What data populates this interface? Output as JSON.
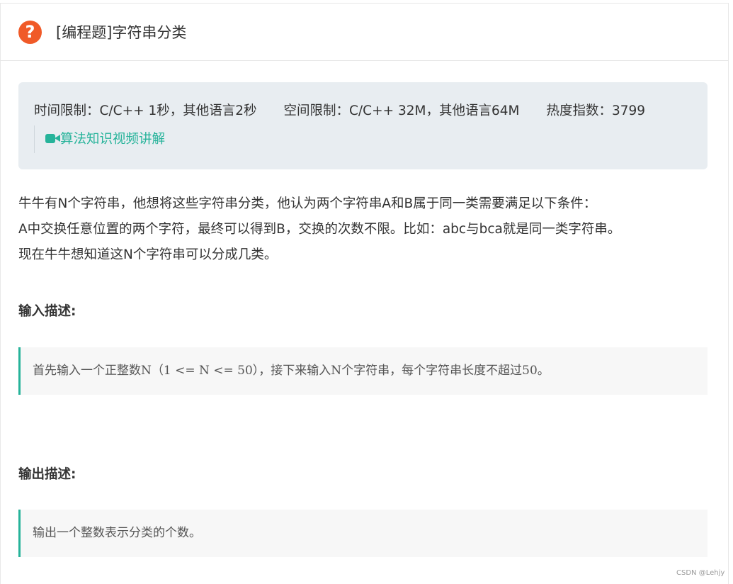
{
  "problem": {
    "title": "[编程题]字符串分类",
    "icon": "question-mark-icon"
  },
  "info": {
    "time_limit": "时间限制：C/C++ 1秒，其他语言2秒",
    "space_limit": "空间限制：C/C++ 32M，其他语言64M",
    "heat_index": "热度指数：3799",
    "video_link": "算法知识视频讲解",
    "video_icon": "video-camera-icon"
  },
  "description": {
    "lines": [
      "牛牛有N个字符串，他想将这些字符串分类，他认为两个字符串A和B属于同一类需要满足以下条件：",
      "A中交换任意位置的两个字符，最终可以得到B，交换的次数不限。比如：abc与bca就是同一类字符串。",
      "现在牛牛想知道这N个字符串可以分成几类。"
    ]
  },
  "input": {
    "heading": "输入描述:",
    "text": "首先输入一个正整数N（1 <= N <= 50），接下来输入N个字符串，每个字符串长度不超过50。"
  },
  "output": {
    "heading": "输出描述:",
    "text": "输出一个整数表示分类的个数。"
  },
  "watermark": "CSDN @Lehjy",
  "colors": {
    "accent": "#26b39a",
    "icon_orange": "#f05a28",
    "info_bg": "#e8edf1",
    "quote_bg": "#f7f7f7"
  }
}
